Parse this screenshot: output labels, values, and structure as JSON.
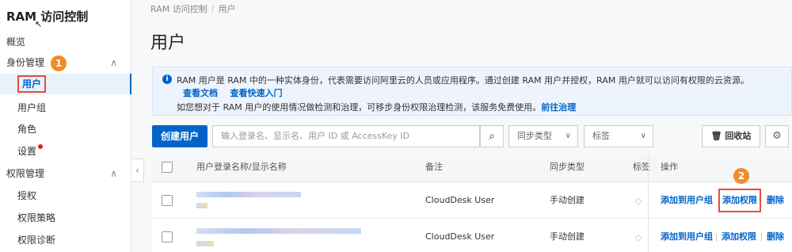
{
  "sidebar": {
    "title": "RAM 访问控制",
    "items": [
      {
        "label": "概览"
      },
      {
        "label": "身份管理"
      },
      {
        "label": "用户"
      },
      {
        "label": "用户组"
      },
      {
        "label": "角色"
      },
      {
        "label": "设置"
      },
      {
        "label": "权限管理"
      },
      {
        "label": "授权"
      },
      {
        "label": "权限策略"
      },
      {
        "label": "权限诊断"
      }
    ],
    "marker": "1"
  },
  "breadcrumb": [
    "RAM 访问控制",
    "用户"
  ],
  "page_title": "用户",
  "info": {
    "line1": "RAM 用户是 RAM 中的一种实体身份，代表需要访问阿里云的人员或应用程序。通过创建 RAM 用户并授权，RAM 用户就可以访问有权限的云资源。",
    "link_docs": "查看文档",
    "link_quickstart": "查看快速入门",
    "line3": "如您想对于 RAM 用户的使用情况做检测和治理，可移步身份权限治理检测，该服务免费使用。",
    "link_governance": "前往治理"
  },
  "toolbar": {
    "create_label": "创建用户",
    "search_placeholder": "输入登录名、显示名、用户 ID 或 AccessKey ID",
    "sync_type_label": "同步类型",
    "tag_label": "标签",
    "recycle_label": "回收站"
  },
  "table": {
    "headers": {
      "name": "用户登录名称/显示名称",
      "note": "备注",
      "sync": "同步类型",
      "tag": "标签",
      "ops": "操作"
    },
    "rows": [
      {
        "note": "CloudDesk User",
        "sync": "手动创建",
        "op_add_group": "添加到用户组",
        "op_add_perm": "添加权限",
        "op_delete": "删除"
      },
      {
        "note": "CloudDesk User",
        "sync": "手动创建",
        "op_add_group": "添加到用户组",
        "op_add_perm": "添加权限",
        "op_delete": "删除"
      }
    ],
    "marker": "2"
  },
  "colors": {
    "accent": "#0064c8",
    "highlight": "#e74c3c",
    "marker": "#f28c28"
  }
}
